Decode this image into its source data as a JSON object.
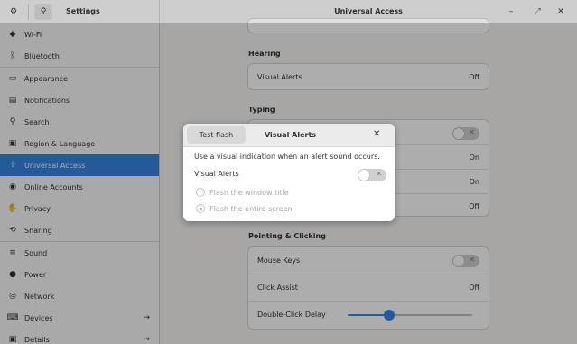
{
  "titlebar": {
    "left_title": "Settings",
    "main_title": "Universal Access",
    "gear_icon": "⚙",
    "search_icon": "⚲",
    "minimize_icon": "–",
    "maximize_icon": "⤢",
    "close_icon": "✕"
  },
  "sidebar": {
    "items": [
      {
        "label": "Wi-Fi",
        "icon": "◆"
      },
      {
        "label": "Bluetooth",
        "icon": "ᛒ"
      },
      {
        "label": "Appearance",
        "icon": "▭"
      },
      {
        "label": "Notifications",
        "icon": "▤"
      },
      {
        "label": "Search",
        "icon": "⚲"
      },
      {
        "label": "Region & Language",
        "icon": "▣"
      },
      {
        "label": "Universal Access",
        "icon": "☥"
      },
      {
        "label": "Online Accounts",
        "icon": "◉"
      },
      {
        "label": "Privacy",
        "icon": "✋"
      },
      {
        "label": "Sharing",
        "icon": "⟲"
      },
      {
        "label": "Sound",
        "icon": "≡"
      },
      {
        "label": "Power",
        "icon": "●"
      },
      {
        "label": "Network",
        "icon": "◎"
      },
      {
        "label": "Devices",
        "icon": "⌨",
        "arrow": "→"
      },
      {
        "label": "Details",
        "icon": "▣",
        "arrow": "→"
      }
    ]
  },
  "main": {
    "hearing": {
      "title": "Hearing",
      "rows": [
        {
          "label": "Visual Alerts",
          "value": "Off"
        }
      ]
    },
    "typing": {
      "title": "Typing",
      "rows": [
        {
          "label": "",
          "value": ""
        },
        {
          "label": "",
          "value": "On"
        },
        {
          "label": "",
          "value": "On"
        },
        {
          "label": "",
          "value": "Off"
        }
      ]
    },
    "pointing": {
      "title": "Pointing & Clicking",
      "rows": [
        {
          "label": "Mouse Keys",
          "value": ""
        },
        {
          "label": "Click Assist",
          "value": "Off"
        },
        {
          "label": "Double-Click Delay",
          "value": ""
        }
      ],
      "double_click_delay_fraction": 0.33
    }
  },
  "dialog": {
    "test_button": "Test flash",
    "title": "Visual Alerts",
    "close_icon": "✕",
    "description": "Use a visual indication when an alert sound occurs.",
    "toggle_label": "Visual Alerts",
    "toggle_state": "off",
    "options": [
      {
        "label": "Flash the window title",
        "checked": false
      },
      {
        "label": "Flash the entire screen",
        "checked": true
      }
    ]
  },
  "colors": {
    "accent": "#3584e4",
    "switch_off": "#d0d0d0"
  }
}
